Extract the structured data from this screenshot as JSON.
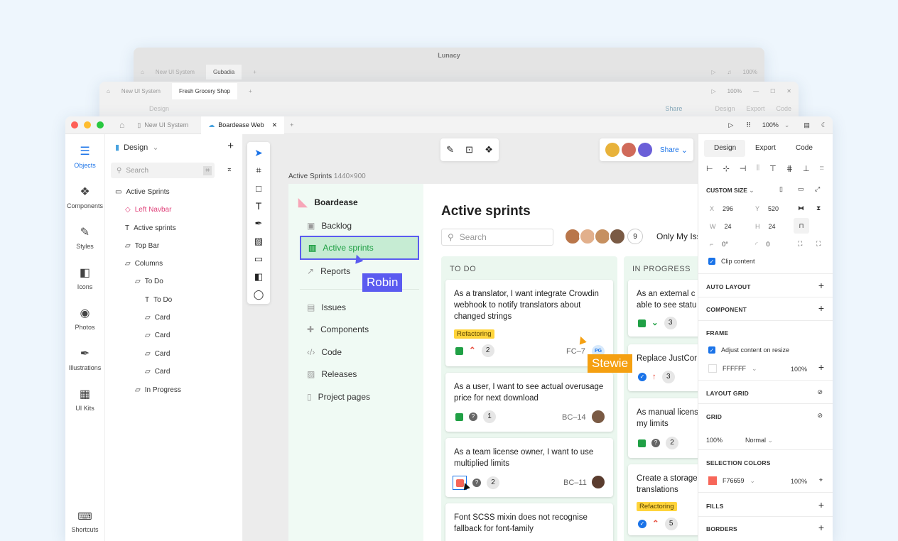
{
  "app_title": "Lunacy",
  "bg1": {
    "tabs": [
      "New UI System",
      "Gubadia"
    ],
    "zoom": "100%"
  },
  "bg2": {
    "tabs": [
      "New UI System",
      "Fresh Grocery Shop"
    ],
    "zoom": "100%",
    "page": "Design",
    "share": "Share",
    "rtabs": [
      "Design",
      "Export",
      "Code"
    ]
  },
  "main": {
    "tabs": [
      "New UI System",
      "Boardease Web"
    ],
    "zoom": "100%",
    "rail": [
      "Objects",
      "Components",
      "Styles",
      "Icons",
      "Photos",
      "Illustrations",
      "UI Kits",
      "Shortcuts"
    ],
    "page_name": "Design",
    "search_placeholder": "Search",
    "layers": [
      "Active Sprints",
      "Left Navbar",
      "Active sprints",
      "Top Bar",
      "Columns",
      "To Do",
      "To Do",
      "Card",
      "Card",
      "Card",
      "Card",
      "In Progress"
    ],
    "share": "Share",
    "artboard_label": "Active Sprints",
    "artboard_size": "1440×900"
  },
  "boardease": {
    "brand": "Boardease",
    "nav": [
      "Backlog",
      "Active sprints",
      "Reports",
      "Issues",
      "Components",
      "Code",
      "Releases",
      "Project pages"
    ],
    "title": "Active sprints",
    "search_placeholder": "Search",
    "avatar_count": "9",
    "filter": "Only My Iss",
    "col1": "TO DO",
    "col2": "IN PROGRESS",
    "cards1": [
      {
        "text": "As a translator, I want integrate Crowdin webhook to notify translators about changed strings",
        "badge": "Refactoring",
        "count": "2",
        "id": "FC–7",
        "ava": "PG"
      },
      {
        "text": "As a user, I want to see actual overusage price for next download",
        "count": "1",
        "id": "BC–14"
      },
      {
        "text": "As a team license owner, I want to use multiplied limits",
        "count": "2",
        "id": "BC–11"
      },
      {
        "text": "Font SCSS mixin does not recognise fallback for font-family"
      }
    ],
    "cards2": [
      {
        "text": "As an external c able to see statu",
        "count": "3"
      },
      {
        "text": "Replace JustCor",
        "count": "3"
      },
      {
        "text": "As manual licens my limits",
        "count": "2"
      },
      {
        "text": "Create a storage translations",
        "badge": "Refactoring",
        "count": "5"
      }
    ]
  },
  "cursors": {
    "robin": "Robin",
    "stewie": "Stewie"
  },
  "inspector": {
    "tabs": [
      "Design",
      "Export",
      "Code"
    ],
    "custom_size": "CUSTOM SIZE",
    "x": "296",
    "y": "520",
    "w": "24",
    "h": "24",
    "rot": "0°",
    "radius": "0",
    "clip": "Clip content",
    "auto_layout": "AUTO LAYOUT",
    "component": "COMPONENT",
    "frame": "FRAME",
    "adjust": "Adjust content on resize",
    "fill_hex": "FFFFFF",
    "fill_op": "100%",
    "layout_grid": "LAYOUT GRID",
    "grid": "GRID",
    "grid_op": "100%",
    "grid_mode": "Normal",
    "selection_colors": "SELECTION COLORS",
    "sel_hex": "F76659",
    "sel_op": "100%",
    "fills": "FILLS",
    "borders": "BORDERS"
  },
  "colors": {
    "accent": "#1a73e8",
    "green": "#20a045",
    "robin": "#5b5bf0",
    "stewie": "#f5a011",
    "sel": "#f76659"
  }
}
